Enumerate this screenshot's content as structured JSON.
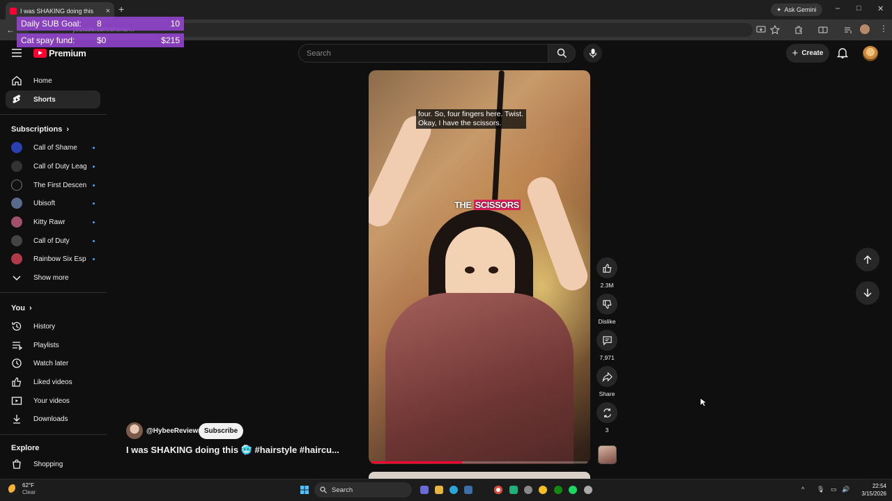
{
  "browser": {
    "tab_title": "I was SHAKING doing this",
    "tab_close": "×",
    "new_tab": "+",
    "ask_gemini": "Ask Gemini",
    "url": "youtube.com/shorts/...",
    "window_controls": [
      "–",
      "□",
      "✕"
    ]
  },
  "overlay": {
    "sub_goal_label": "Daily SUB Goal:",
    "sub_goal_current": "8",
    "sub_goal_target": "10",
    "fund_label": "Cat spay fund:",
    "fund_current": "$0",
    "fund_target": "$215"
  },
  "header": {
    "logo_text": "Premium",
    "search_placeholder": "Search",
    "create_label": "Create"
  },
  "sidebar": {
    "main": [
      {
        "label": "Home",
        "icon": "home-icon"
      },
      {
        "label": "Shorts",
        "icon": "shorts-icon",
        "active": true
      }
    ],
    "subscriptions_heading": "Subscriptions",
    "subscriptions": [
      {
        "label": "Call of Shame",
        "color": "#2a3fb0"
      },
      {
        "label": "Call of Duty Leag...",
        "color": "#333333"
      },
      {
        "label": "The First Descen...",
        "color": "#111111"
      },
      {
        "label": "Ubisoft",
        "color": "#5a6a8a"
      },
      {
        "label": "Kitty Rawr",
        "color": "#a0506a"
      },
      {
        "label": "Call of Duty",
        "color": "#444444"
      },
      {
        "label": "Rainbow Six Esp...",
        "color": "#b03a4a"
      }
    ],
    "show_more": "Show more",
    "you_heading": "You",
    "you_items": [
      {
        "label": "History",
        "icon": "history-icon"
      },
      {
        "label": "Playlists",
        "icon": "playlists-icon"
      },
      {
        "label": "Watch later",
        "icon": "watch-later-icon"
      },
      {
        "label": "Liked videos",
        "icon": "liked-videos-icon"
      },
      {
        "label": "Your videos",
        "icon": "your-videos-icon"
      },
      {
        "label": "Downloads",
        "icon": "downloads-icon"
      }
    ],
    "explore_heading": "Explore",
    "explore_items": [
      {
        "label": "Shopping",
        "icon": "shopping-icon"
      }
    ]
  },
  "short": {
    "caption_line1": "four. So, four fingers here. Twist.",
    "caption_line2": "Okay, I have the scissors.",
    "burned_text_a": "THE ",
    "burned_text_b": "SCISSORS",
    "progress": 0.42,
    "channel": "@HybeeReviews",
    "subscribe_label": "Subscribe",
    "title": "I was SHAKING doing this 🥶 #hairstyle #haircu..."
  },
  "actions": {
    "likes": "2.3M",
    "dislike": "Dislike",
    "comments": "7,971",
    "share": "Share",
    "remix": "3"
  },
  "taskbar": {
    "weather_temp": "62°F",
    "weather_desc": "Clear",
    "search": "Search",
    "time": "22:54",
    "date": "3/15/2026"
  },
  "colors": {
    "brand": "#ff0033",
    "overlay": "#9646d2",
    "accent": "#3ea6ff"
  }
}
